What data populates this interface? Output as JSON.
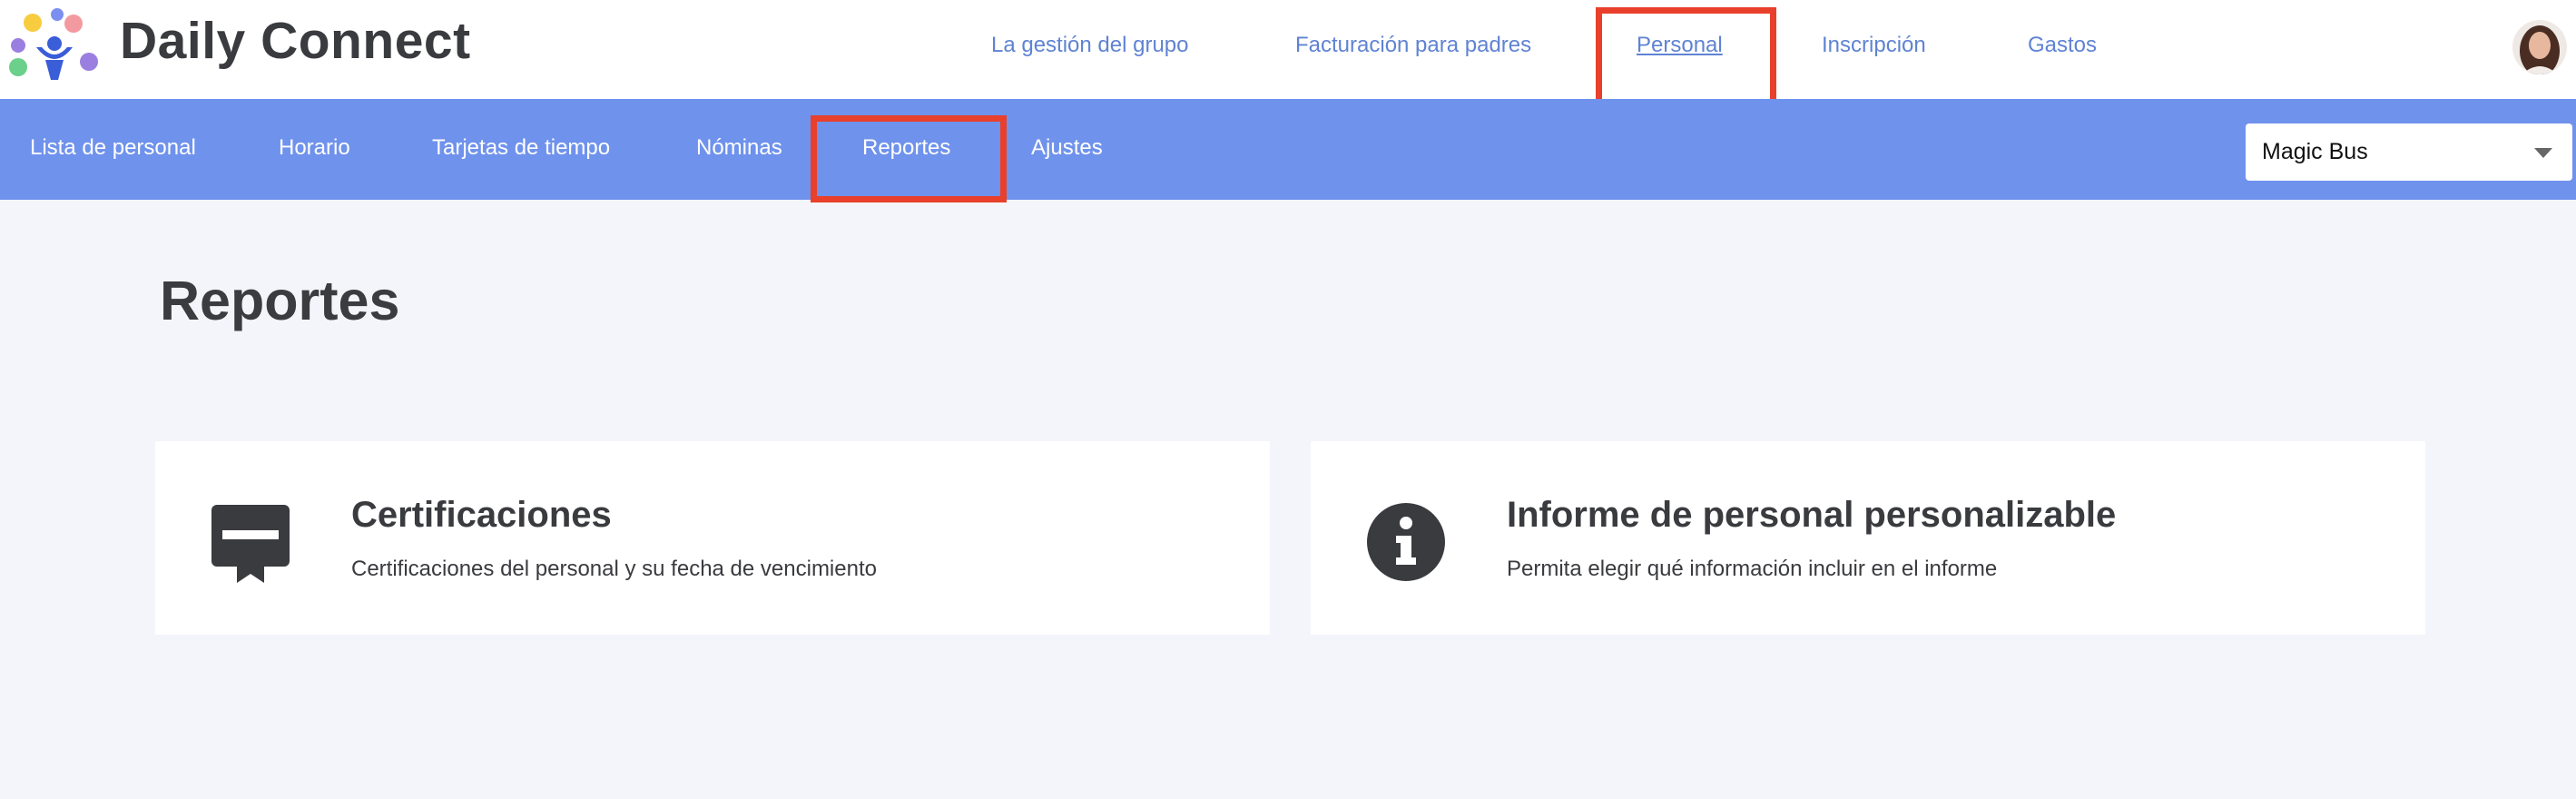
{
  "app": {
    "brand": "Daily Connect"
  },
  "top_nav": {
    "items": [
      {
        "label": "La gestión del grupo"
      },
      {
        "label": "Facturación para padres"
      },
      {
        "label": "Personal"
      },
      {
        "label": "Inscripción"
      },
      {
        "label": "Gastos"
      }
    ],
    "active": "Personal"
  },
  "sub_nav": {
    "items": [
      {
        "label": "Lista de personal"
      },
      {
        "label": "Horario"
      },
      {
        "label": "Tarjetas de tiempo"
      },
      {
        "label": "Nóminas"
      },
      {
        "label": "Reportes"
      },
      {
        "label": "Ajustes"
      }
    ],
    "active": "Reportes"
  },
  "center_select": {
    "value": "Magic Bus"
  },
  "page": {
    "title": "Reportes"
  },
  "cards": [
    {
      "title": "Certificaciones",
      "description": "Certificaciones del personal y su fecha de vencimiento",
      "icon": "certificate-icon"
    },
    {
      "title": "Informe de personal personalizable",
      "description": "Permita elegir qué información incluir en el informe",
      "icon": "info-icon"
    }
  ],
  "colors": {
    "accent": "#6f92ec",
    "nav_link": "#5f83d3",
    "highlight": "#e8402b",
    "background": "#f4f5fa"
  }
}
